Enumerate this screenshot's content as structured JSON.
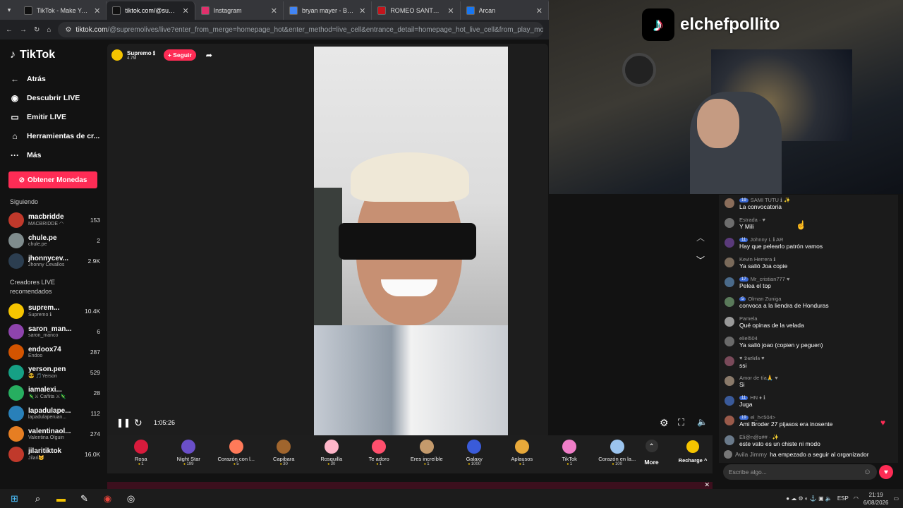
{
  "browser": {
    "tabs": [
      {
        "label": "TikTok - Make Your Day",
        "color": "#111",
        "active": false
      },
      {
        "label": "tiktok.com/@supremo",
        "color": "#111",
        "active": true
      },
      {
        "label": "Instagram",
        "color": "#e1306c",
        "active": false
      },
      {
        "label": "bryan mayer - Buscar con",
        "color": "#4285f4",
        "active": false
      },
      {
        "label": "ROMEO SANTOS PRINCE",
        "color": "#c4151c",
        "active": false
      },
      {
        "label": "Arcan",
        "color": "#1877f2",
        "active": false
      }
    ],
    "url_host": "tiktok.com",
    "url_rest": "/@supremolives/live?enter_from_merge=homepage_hot&enter_method=live_cell&entrance_detail=homepage_hot_live_cell&from_play_mode=one"
  },
  "sidebar": {
    "brand": "TikTok",
    "nav": [
      {
        "icon": "←",
        "label": "Atrás",
        "name": "back"
      },
      {
        "icon": "◉",
        "label": "Descubrir LIVE",
        "name": "discover-live"
      },
      {
        "icon": "▭",
        "label": "Emitir LIVE",
        "name": "go-live"
      },
      {
        "icon": "⌂",
        "label": "Herramientas de cr...",
        "name": "creator-tools"
      },
      {
        "icon": "···",
        "label": "Más",
        "name": "more"
      }
    ],
    "coins_button": "Obtener Monedas",
    "following_title": "Siguiendo",
    "following": [
      {
        "name": "macbridde",
        "sub": "MACBRIDDE ◠",
        "count": "153",
        "color": "#c0392b"
      },
      {
        "name": "chule.pe",
        "sub": "chule.pe",
        "count": "2",
        "color": "#7f8c8d"
      },
      {
        "name": "jhonnycev...",
        "sub": "Jhonny Cevallos",
        "count": "2.9K",
        "color": "#2c3e50"
      }
    ],
    "recommended_title": "Creadores LIVE recomendados",
    "recommended": [
      {
        "name": "suprem...",
        "sub": "Supremo ℹ",
        "count": "10.4K",
        "color": "#f5c400"
      },
      {
        "name": "saron_man...",
        "sub": "saron_manco",
        "count": "6",
        "color": "#8e44ad"
      },
      {
        "name": "endoox74",
        "sub": "Endoo",
        "count": "287",
        "color": "#d35400"
      },
      {
        "name": "yerson.pen",
        "sub": "😎 🎵Yerson",
        "count": "529",
        "color": "#16a085"
      },
      {
        "name": "iamalexi...",
        "sub": "🦎⚔ Cañita ⚔🦎",
        "count": "28",
        "color": "#27ae60"
      },
      {
        "name": "lapadulape...",
        "sub": "lapadulaperuan...",
        "count": "112",
        "color": "#2980b9"
      },
      {
        "name": "valentinaol...",
        "sub": "Valentina Olguin",
        "count": "274",
        "color": "#e67e22"
      },
      {
        "name": "jilaritiktok",
        "sub": "Jilari😺",
        "count": "16.0K",
        "color": "#c0392b"
      }
    ]
  },
  "host": {
    "name": "Supremo ℹ",
    "followers": "4.7M",
    "follow_label": "+ Seguir"
  },
  "player": {
    "elapsed": "1:05:26"
  },
  "gifts": [
    {
      "name": "Rosa",
      "price": "1",
      "color": "#d81b3c"
    },
    {
      "name": "Night Star",
      "price": "199",
      "color": "#6a4fc9"
    },
    {
      "name": "Corazón con l...",
      "price": "5",
      "color": "#ff7a59"
    },
    {
      "name": "Capibara",
      "price": "30",
      "color": "#a0652d"
    },
    {
      "name": "Rosquilla",
      "price": "30",
      "color": "#ffb6c9"
    },
    {
      "name": "Te adoro",
      "price": "1",
      "color": "#ff4f6d"
    },
    {
      "name": "Eres increíble",
      "price": "1",
      "color": "#c49a6c"
    },
    {
      "name": "Galaxy",
      "price": "1000",
      "color": "#3a5bd9"
    },
    {
      "name": "Aplausos",
      "price": "1",
      "color": "#e8a93a"
    },
    {
      "name": "TikTok",
      "price": "1",
      "color": "#f07ec8"
    },
    {
      "name": "Corazón en la...",
      "price": "100",
      "color": "#9bc4ee"
    }
  ],
  "more_label": "More",
  "recharge_label": "Recharge ^",
  "streamer_brand": "elchefpollito",
  "chat": {
    "messages": [
      {
        "user": "SAMI TUTU ℹ ✨",
        "badge": "19",
        "text": "La convocatoria",
        "color": "#8a6d5a"
      },
      {
        "user": "Estrada · ♥",
        "badge": "",
        "text": "Y Mili",
        "color": "#6d6d6d"
      },
      {
        "user": "Johnny L ℹ AR",
        "badge": "11",
        "text": "Hay que pelearlo patrón vamos",
        "color": "#5a3a7a"
      },
      {
        "user": "Kevin Herrera ℹ",
        "badge": "",
        "text": "Ya salió Joa copie",
        "color": "#7a6a5a"
      },
      {
        "user": "Mr_cristian777 ♥",
        "badge": "17",
        "text": "Pelea el top",
        "color": "#4a6a8a"
      },
      {
        "user": "Olman Zuniga",
        "badge": "5",
        "text": "convoca a la liendra de Honduras",
        "color": "#5a7a5a"
      },
      {
        "user": "Pamela",
        "badge": "",
        "text": "Qué opinas de la velada",
        "color": "#9a9a9a"
      },
      {
        "user": "eliel504",
        "badge": "",
        "text": "Ya salió joao (copien y peguen)",
        "color": "#6a6a6a"
      },
      {
        "user": "♥ 𝕯𝖆𝖗𝖎𝖊𝖑𝖆 ♥",
        "badge": "",
        "text": "ssi",
        "color": "#7a4a5a"
      },
      {
        "user": "Amor de tía🙏 ♥",
        "badge": "",
        "text": "Si",
        "color": "#8a7a6a"
      },
      {
        "user": "HN ♦ ℹ",
        "badge": "11",
        "text": "Juga",
        "color": "#3a5a9a"
      },
      {
        "user": "el_h<504>",
        "badge": "19",
        "text": "Ami Broder 27 pijasos era inosente",
        "color": "#9a5a4a"
      },
      {
        "user": "Eli@n@s## · ✨",
        "badge": "",
        "text": "este vato es un chiste ni modo",
        "color": "#6a7a8a"
      }
    ],
    "join_user": "Avila Jimmy",
    "join_text": "ha empezado a seguir al organizador",
    "input_placeholder": "Escribe algo..."
  },
  "taskbar": {
    "lang": "ESP",
    "time": "21:19",
    "date": "6/08/2026"
  }
}
